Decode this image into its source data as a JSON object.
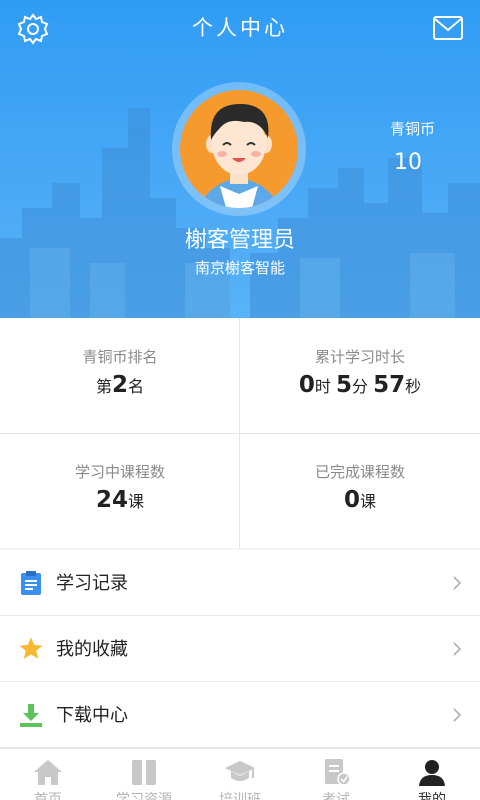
{
  "header": {
    "title": "个人中心",
    "user_name": "榭客管理员",
    "organization": "南京榭客智能",
    "coin_label": "青铜币",
    "coin_value": "10"
  },
  "stats": {
    "ranking": {
      "label": "青铜币排名",
      "prefix": "第",
      "value": "2",
      "suffix": "名"
    },
    "study_time": {
      "label": "累计学习时长",
      "hours": "0",
      "hours_unit": "时",
      "minutes": "5",
      "minutes_unit": "分",
      "seconds": "57",
      "seconds_unit": "秒"
    },
    "in_progress": {
      "label": "学习中课程数",
      "value": "24",
      "unit": "课"
    },
    "completed": {
      "label": "已完成课程数",
      "value": "0",
      "unit": "课"
    }
  },
  "menu": [
    {
      "label": "学习记录",
      "icon": "clipboard-icon"
    },
    {
      "label": "我的收藏",
      "icon": "star-icon"
    },
    {
      "label": "下载中心",
      "icon": "download-icon"
    }
  ],
  "tabs": [
    {
      "label": "首页",
      "icon": "home-icon"
    },
    {
      "label": "学习资源",
      "icon": "book-icon"
    },
    {
      "label": "培训班",
      "icon": "graduation-cap-icon"
    },
    {
      "label": "考试",
      "icon": "exam-icon"
    },
    {
      "label": "我的",
      "icon": "user-icon"
    }
  ],
  "colors": {
    "header_blue": "#2f9cf4",
    "avatar_orange": "#f79a2d",
    "star_yellow": "#f7b731",
    "download_green": "#5cc25b",
    "clipboard_blue": "#3b8ff0"
  }
}
